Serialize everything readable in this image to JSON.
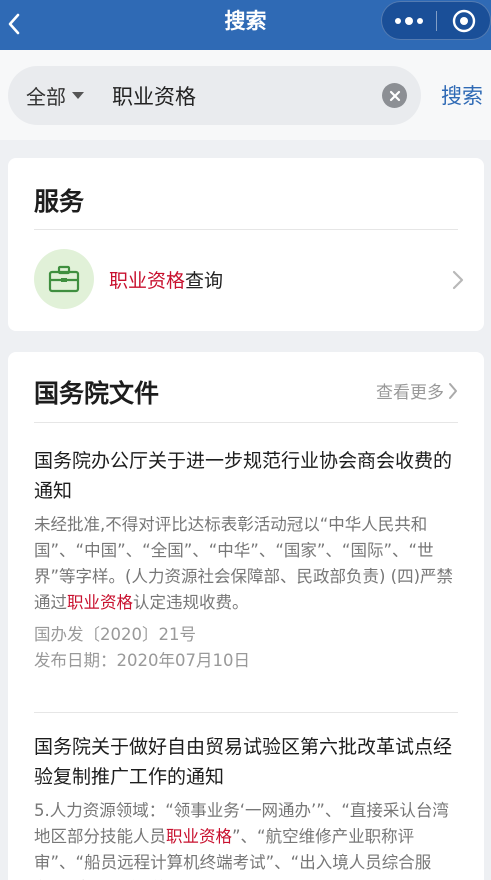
{
  "navbar": {
    "title": "搜索"
  },
  "search": {
    "scope": "全部",
    "query": "职业资格",
    "button": "搜索"
  },
  "services": {
    "title": "服务",
    "items": [
      {
        "label_highlight": "职业资格",
        "label_rest": "查询",
        "icon": "briefcase-icon"
      }
    ]
  },
  "docs": {
    "title": "国务院文件",
    "see_more": "查看更多",
    "items": [
      {
        "title": "国务院办公厅关于进一步规范行业协会商会收费的通知",
        "snippet_before": "未经批准,不得对评比达标表彰活动冠以“中华人民共和国”、“中国”、“全国”、“中华”、“国家”、“国际”、“世界”等字样。(人力资源社会保障部、民政部负责) (四)严禁通过",
        "snippet_highlight": "职业资格",
        "snippet_after": "认定违规收费。",
        "doc_number": "国办发〔2020〕21号",
        "publish_date": "发布日期：2020年07月10日"
      },
      {
        "title": "国务院关于做好自由贸易试验区第六批改革试点经验复制推广工作的通知",
        "snippet_before": "5.人力资源领域：“领事业务‘一网通办’”、“直接采认台湾地区部分技能人员",
        "snippet_highlight": "职业资格",
        "snippet_after": "”、“航空维修产业职称评审”、“船员远程计算机终端考试”、“出入境人员综合服务‘一站式’平台”等",
        "doc_number": "",
        "publish_date": ""
      }
    ]
  },
  "colors": {
    "brand": "#2f6ab5",
    "highlight": "#c8102e",
    "service_icon_bg": "#e1f1d8",
    "service_icon_fg": "#3f8f3f"
  }
}
